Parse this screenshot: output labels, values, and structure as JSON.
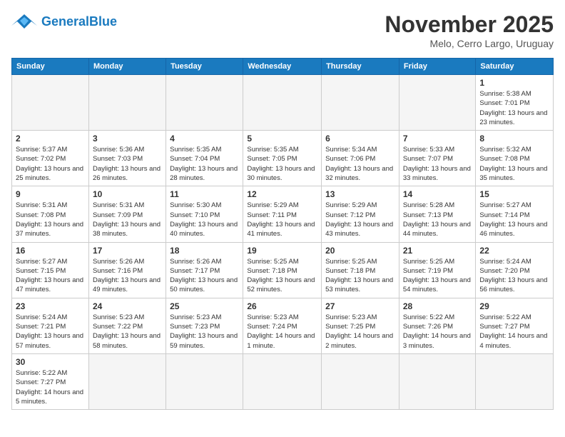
{
  "header": {
    "logo_general": "General",
    "logo_blue": "Blue",
    "month_title": "November 2025",
    "subtitle": "Melo, Cerro Largo, Uruguay"
  },
  "weekdays": [
    "Sunday",
    "Monday",
    "Tuesday",
    "Wednesday",
    "Thursday",
    "Friday",
    "Saturday"
  ],
  "weeks": [
    [
      {
        "day": "",
        "empty": true
      },
      {
        "day": "",
        "empty": true
      },
      {
        "day": "",
        "empty": true
      },
      {
        "day": "",
        "empty": true
      },
      {
        "day": "",
        "empty": true
      },
      {
        "day": "",
        "empty": true
      },
      {
        "day": "1",
        "sunrise": "Sunrise: 5:38 AM",
        "sunset": "Sunset: 7:01 PM",
        "daylight": "Daylight: 13 hours and 23 minutes."
      }
    ],
    [
      {
        "day": "2",
        "sunrise": "Sunrise: 5:37 AM",
        "sunset": "Sunset: 7:02 PM",
        "daylight": "Daylight: 13 hours and 25 minutes."
      },
      {
        "day": "3",
        "sunrise": "Sunrise: 5:36 AM",
        "sunset": "Sunset: 7:03 PM",
        "daylight": "Daylight: 13 hours and 26 minutes."
      },
      {
        "day": "4",
        "sunrise": "Sunrise: 5:35 AM",
        "sunset": "Sunset: 7:04 PM",
        "daylight": "Daylight: 13 hours and 28 minutes."
      },
      {
        "day": "5",
        "sunrise": "Sunrise: 5:35 AM",
        "sunset": "Sunset: 7:05 PM",
        "daylight": "Daylight: 13 hours and 30 minutes."
      },
      {
        "day": "6",
        "sunrise": "Sunrise: 5:34 AM",
        "sunset": "Sunset: 7:06 PM",
        "daylight": "Daylight: 13 hours and 32 minutes."
      },
      {
        "day": "7",
        "sunrise": "Sunrise: 5:33 AM",
        "sunset": "Sunset: 7:07 PM",
        "daylight": "Daylight: 13 hours and 33 minutes."
      },
      {
        "day": "8",
        "sunrise": "Sunrise: 5:32 AM",
        "sunset": "Sunset: 7:08 PM",
        "daylight": "Daylight: 13 hours and 35 minutes."
      }
    ],
    [
      {
        "day": "9",
        "sunrise": "Sunrise: 5:31 AM",
        "sunset": "Sunset: 7:08 PM",
        "daylight": "Daylight: 13 hours and 37 minutes."
      },
      {
        "day": "10",
        "sunrise": "Sunrise: 5:31 AM",
        "sunset": "Sunset: 7:09 PM",
        "daylight": "Daylight: 13 hours and 38 minutes."
      },
      {
        "day": "11",
        "sunrise": "Sunrise: 5:30 AM",
        "sunset": "Sunset: 7:10 PM",
        "daylight": "Daylight: 13 hours and 40 minutes."
      },
      {
        "day": "12",
        "sunrise": "Sunrise: 5:29 AM",
        "sunset": "Sunset: 7:11 PM",
        "daylight": "Daylight: 13 hours and 41 minutes."
      },
      {
        "day": "13",
        "sunrise": "Sunrise: 5:29 AM",
        "sunset": "Sunset: 7:12 PM",
        "daylight": "Daylight: 13 hours and 43 minutes."
      },
      {
        "day": "14",
        "sunrise": "Sunrise: 5:28 AM",
        "sunset": "Sunset: 7:13 PM",
        "daylight": "Daylight: 13 hours and 44 minutes."
      },
      {
        "day": "15",
        "sunrise": "Sunrise: 5:27 AM",
        "sunset": "Sunset: 7:14 PM",
        "daylight": "Daylight: 13 hours and 46 minutes."
      }
    ],
    [
      {
        "day": "16",
        "sunrise": "Sunrise: 5:27 AM",
        "sunset": "Sunset: 7:15 PM",
        "daylight": "Daylight: 13 hours and 47 minutes."
      },
      {
        "day": "17",
        "sunrise": "Sunrise: 5:26 AM",
        "sunset": "Sunset: 7:16 PM",
        "daylight": "Daylight: 13 hours and 49 minutes."
      },
      {
        "day": "18",
        "sunrise": "Sunrise: 5:26 AM",
        "sunset": "Sunset: 7:17 PM",
        "daylight": "Daylight: 13 hours and 50 minutes."
      },
      {
        "day": "19",
        "sunrise": "Sunrise: 5:25 AM",
        "sunset": "Sunset: 7:18 PM",
        "daylight": "Daylight: 13 hours and 52 minutes."
      },
      {
        "day": "20",
        "sunrise": "Sunrise: 5:25 AM",
        "sunset": "Sunset: 7:18 PM",
        "daylight": "Daylight: 13 hours and 53 minutes."
      },
      {
        "day": "21",
        "sunrise": "Sunrise: 5:25 AM",
        "sunset": "Sunset: 7:19 PM",
        "daylight": "Daylight: 13 hours and 54 minutes."
      },
      {
        "day": "22",
        "sunrise": "Sunrise: 5:24 AM",
        "sunset": "Sunset: 7:20 PM",
        "daylight": "Daylight: 13 hours and 56 minutes."
      }
    ],
    [
      {
        "day": "23",
        "sunrise": "Sunrise: 5:24 AM",
        "sunset": "Sunset: 7:21 PM",
        "daylight": "Daylight: 13 hours and 57 minutes."
      },
      {
        "day": "24",
        "sunrise": "Sunrise: 5:23 AM",
        "sunset": "Sunset: 7:22 PM",
        "daylight": "Daylight: 13 hours and 58 minutes."
      },
      {
        "day": "25",
        "sunrise": "Sunrise: 5:23 AM",
        "sunset": "Sunset: 7:23 PM",
        "daylight": "Daylight: 13 hours and 59 minutes."
      },
      {
        "day": "26",
        "sunrise": "Sunrise: 5:23 AM",
        "sunset": "Sunset: 7:24 PM",
        "daylight": "Daylight: 14 hours and 1 minute."
      },
      {
        "day": "27",
        "sunrise": "Sunrise: 5:23 AM",
        "sunset": "Sunset: 7:25 PM",
        "daylight": "Daylight: 14 hours and 2 minutes."
      },
      {
        "day": "28",
        "sunrise": "Sunrise: 5:22 AM",
        "sunset": "Sunset: 7:26 PM",
        "daylight": "Daylight: 14 hours and 3 minutes."
      },
      {
        "day": "29",
        "sunrise": "Sunrise: 5:22 AM",
        "sunset": "Sunset: 7:27 PM",
        "daylight": "Daylight: 14 hours and 4 minutes."
      }
    ],
    [
      {
        "day": "30",
        "sunrise": "Sunrise: 5:22 AM",
        "sunset": "Sunset: 7:27 PM",
        "daylight": "Daylight: 14 hours and 5 minutes."
      },
      {
        "day": "",
        "empty": true
      },
      {
        "day": "",
        "empty": true
      },
      {
        "day": "",
        "empty": true
      },
      {
        "day": "",
        "empty": true
      },
      {
        "day": "",
        "empty": true
      },
      {
        "day": "",
        "empty": true
      }
    ]
  ]
}
